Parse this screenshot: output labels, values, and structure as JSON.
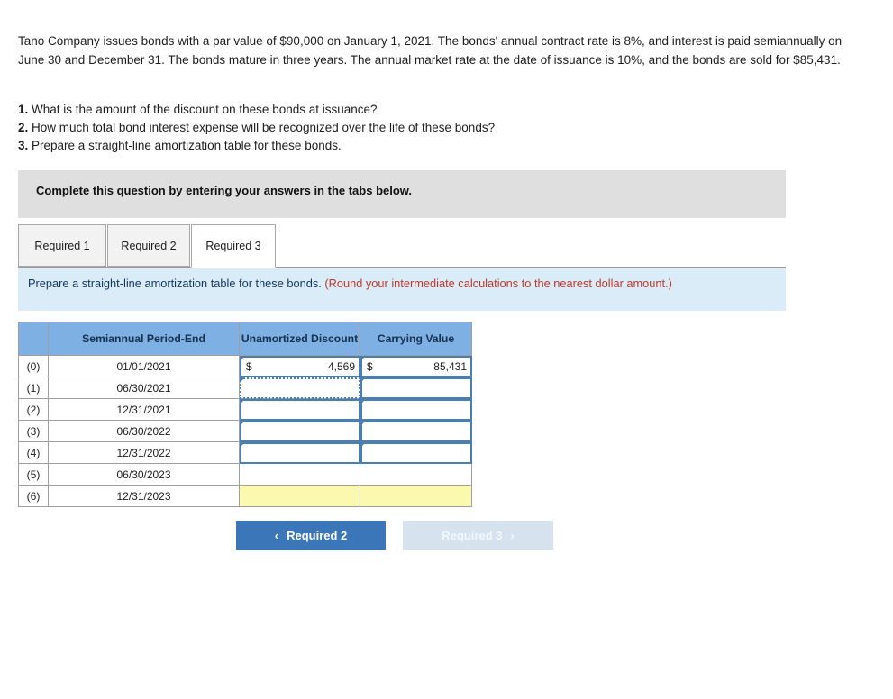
{
  "problem": {
    "text": "Tano Company issues bonds with a par value of $90,000 on January 1, 2021. The bonds' annual contract rate is 8%, and interest is paid semiannually on June 30 and December 31. The bonds mature in three years. The annual market rate at the date of issuance is 10%, and the bonds are sold for $85,431."
  },
  "questions": [
    {
      "num": "1.",
      "text": "What is the amount of the discount on these bonds at issuance?"
    },
    {
      "num": "2.",
      "text": "How much total bond interest expense will be recognized over the life of these bonds?"
    },
    {
      "num": "3.",
      "text": "Prepare a straight-line amortization table for these bonds."
    }
  ],
  "banner": {
    "text": "Complete this question by entering your answers in the tabs below."
  },
  "tabs": [
    {
      "label": "Required 1",
      "active": false
    },
    {
      "label": "Required 2",
      "active": false
    },
    {
      "label": "Required 3",
      "active": true
    }
  ],
  "requirement_panel": {
    "text": "Prepare a straight-line amortization table for these bonds.",
    "hint": "(Round your intermediate calculations to the nearest dollar amount.)"
  },
  "table": {
    "headers": {
      "index": "",
      "period_end": "Semiannual Period-End",
      "unamortized_discount": "Unamortized Discount",
      "carrying_value": "Carrying Value"
    },
    "rows": [
      {
        "index": "(0)",
        "date": "01/01/2021",
        "discount": {
          "currency": "$",
          "value": "4,569",
          "state": "input"
        },
        "carrying": {
          "currency": "$",
          "value": "85,431",
          "state": "input"
        }
      },
      {
        "index": "(1)",
        "date": "06/30/2021",
        "discount": {
          "currency": "",
          "value": "",
          "state": "selected"
        },
        "carrying": {
          "currency": "",
          "value": "",
          "state": "input"
        }
      },
      {
        "index": "(2)",
        "date": "12/31/2021",
        "discount": {
          "currency": "",
          "value": "",
          "state": "input"
        },
        "carrying": {
          "currency": "",
          "value": "",
          "state": "input"
        }
      },
      {
        "index": "(3)",
        "date": "06/30/2022",
        "discount": {
          "currency": "",
          "value": "",
          "state": "input"
        },
        "carrying": {
          "currency": "",
          "value": "",
          "state": "input"
        }
      },
      {
        "index": "(4)",
        "date": "12/31/2022",
        "discount": {
          "currency": "",
          "value": "",
          "state": "input"
        },
        "carrying": {
          "currency": "",
          "value": "",
          "state": "input"
        }
      },
      {
        "index": "(5)",
        "date": "06/30/2023",
        "discount": {
          "currency": "",
          "value": "",
          "state": "plain"
        },
        "carrying": {
          "currency": "",
          "value": "",
          "state": "plain"
        }
      },
      {
        "index": "(6)",
        "date": "12/31/2023",
        "discount": {
          "currency": "",
          "value": "",
          "state": "yellow"
        },
        "carrying": {
          "currency": "",
          "value": "",
          "state": "yellow"
        }
      }
    ]
  },
  "nav": {
    "prev_label": "Required 2",
    "next_label": "Required 3",
    "prev_icon": "chevron-left-icon",
    "next_icon": "chevron-right-icon",
    "prev_chevron": "‹",
    "next_chevron": "›"
  },
  "colors": {
    "primary_button": "#3b77b8",
    "disabled_button": "#d6e3ef",
    "table_header": "#7fb0e4",
    "panel_blue": "#d9ecf8",
    "banner_gray": "#dfdfdf",
    "hint_red": "#c0392b",
    "answer_yellow": "#fbf8b0",
    "cell_outline": "#4a7fb5"
  }
}
